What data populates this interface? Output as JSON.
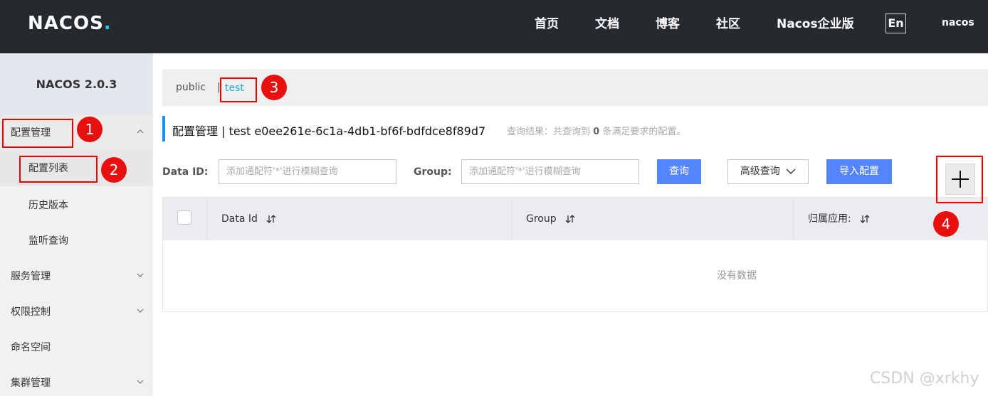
{
  "header": {
    "logo": "NACOS",
    "logo_dot": ".",
    "nav": [
      "首页",
      "文档",
      "博客",
      "社区",
      "Nacos企业版"
    ],
    "lang": "En",
    "user": "nacos"
  },
  "sidebar": {
    "version": "NACOS 2.0.3",
    "items": [
      {
        "label": "配置管理"
      },
      {
        "label": "配置列表"
      },
      {
        "label": "历史版本"
      },
      {
        "label": "监听查询"
      },
      {
        "label": "服务管理"
      },
      {
        "label": "权限控制"
      },
      {
        "label": "命名空间"
      },
      {
        "label": "集群管理"
      }
    ]
  },
  "namespace": {
    "public": "public",
    "sep": "|",
    "test": "test"
  },
  "page": {
    "title": "配置管理  |  test  e0ee261e-6c1a-4db1-bf6f-bdfdce8f89d7",
    "summary_prefix": "查询结果：共查询到",
    "summary_count": "0",
    "summary_suffix": "条满足要求的配置。"
  },
  "search": {
    "dataid_label": "Data ID:",
    "dataid_placeholder": "添加通配符'*'进行模糊查询",
    "group_label": "Group:",
    "group_placeholder": "添加通配符'*'进行模糊查询",
    "query_btn": "查询",
    "advanced_btn": "高级查询",
    "import_btn": "导入配置"
  },
  "table": {
    "columns": [
      "Data Id",
      "Group",
      "归属应用:"
    ],
    "empty": "没有数据"
  },
  "annotations": [
    "1",
    "2",
    "3",
    "4"
  ],
  "watermark": "CSDN @xrkhy",
  "colors": {
    "header_bg": "#252a2f",
    "primary": "#5584ff",
    "link": "#20a8d8",
    "annotation": "#e80f0f"
  }
}
